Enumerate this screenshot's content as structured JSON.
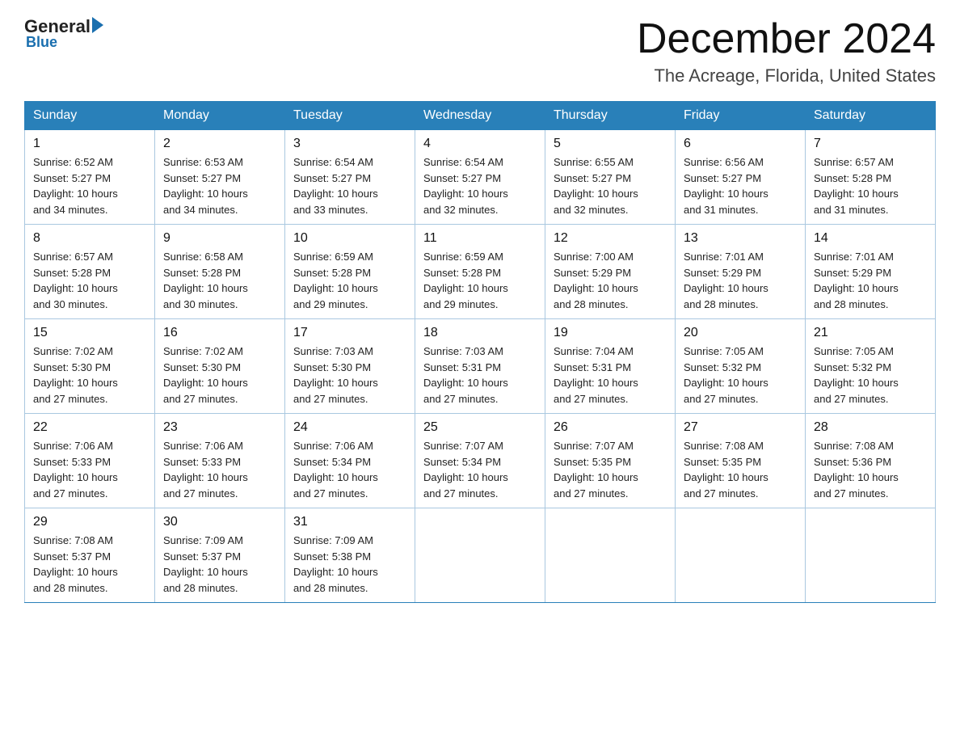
{
  "header": {
    "logo_general": "General",
    "logo_blue": "Blue",
    "title": "December 2024",
    "location": "The Acreage, Florida, United States"
  },
  "weekdays": [
    "Sunday",
    "Monday",
    "Tuesday",
    "Wednesday",
    "Thursday",
    "Friday",
    "Saturday"
  ],
  "weeks": [
    [
      {
        "day": "1",
        "sunrise": "6:52 AM",
        "sunset": "5:27 PM",
        "daylight": "10 hours and 34 minutes."
      },
      {
        "day": "2",
        "sunrise": "6:53 AM",
        "sunset": "5:27 PM",
        "daylight": "10 hours and 34 minutes."
      },
      {
        "day": "3",
        "sunrise": "6:54 AM",
        "sunset": "5:27 PM",
        "daylight": "10 hours and 33 minutes."
      },
      {
        "day": "4",
        "sunrise": "6:54 AM",
        "sunset": "5:27 PM",
        "daylight": "10 hours and 32 minutes."
      },
      {
        "day": "5",
        "sunrise": "6:55 AM",
        "sunset": "5:27 PM",
        "daylight": "10 hours and 32 minutes."
      },
      {
        "day": "6",
        "sunrise": "6:56 AM",
        "sunset": "5:27 PM",
        "daylight": "10 hours and 31 minutes."
      },
      {
        "day": "7",
        "sunrise": "6:57 AM",
        "sunset": "5:28 PM",
        "daylight": "10 hours and 31 minutes."
      }
    ],
    [
      {
        "day": "8",
        "sunrise": "6:57 AM",
        "sunset": "5:28 PM",
        "daylight": "10 hours and 30 minutes."
      },
      {
        "day": "9",
        "sunrise": "6:58 AM",
        "sunset": "5:28 PM",
        "daylight": "10 hours and 30 minutes."
      },
      {
        "day": "10",
        "sunrise": "6:59 AM",
        "sunset": "5:28 PM",
        "daylight": "10 hours and 29 minutes."
      },
      {
        "day": "11",
        "sunrise": "6:59 AM",
        "sunset": "5:28 PM",
        "daylight": "10 hours and 29 minutes."
      },
      {
        "day": "12",
        "sunrise": "7:00 AM",
        "sunset": "5:29 PM",
        "daylight": "10 hours and 28 minutes."
      },
      {
        "day": "13",
        "sunrise": "7:01 AM",
        "sunset": "5:29 PM",
        "daylight": "10 hours and 28 minutes."
      },
      {
        "day": "14",
        "sunrise": "7:01 AM",
        "sunset": "5:29 PM",
        "daylight": "10 hours and 28 minutes."
      }
    ],
    [
      {
        "day": "15",
        "sunrise": "7:02 AM",
        "sunset": "5:30 PM",
        "daylight": "10 hours and 27 minutes."
      },
      {
        "day": "16",
        "sunrise": "7:02 AM",
        "sunset": "5:30 PM",
        "daylight": "10 hours and 27 minutes."
      },
      {
        "day": "17",
        "sunrise": "7:03 AM",
        "sunset": "5:30 PM",
        "daylight": "10 hours and 27 minutes."
      },
      {
        "day": "18",
        "sunrise": "7:03 AM",
        "sunset": "5:31 PM",
        "daylight": "10 hours and 27 minutes."
      },
      {
        "day": "19",
        "sunrise": "7:04 AM",
        "sunset": "5:31 PM",
        "daylight": "10 hours and 27 minutes."
      },
      {
        "day": "20",
        "sunrise": "7:05 AM",
        "sunset": "5:32 PM",
        "daylight": "10 hours and 27 minutes."
      },
      {
        "day": "21",
        "sunrise": "7:05 AM",
        "sunset": "5:32 PM",
        "daylight": "10 hours and 27 minutes."
      }
    ],
    [
      {
        "day": "22",
        "sunrise": "7:06 AM",
        "sunset": "5:33 PM",
        "daylight": "10 hours and 27 minutes."
      },
      {
        "day": "23",
        "sunrise": "7:06 AM",
        "sunset": "5:33 PM",
        "daylight": "10 hours and 27 minutes."
      },
      {
        "day": "24",
        "sunrise": "7:06 AM",
        "sunset": "5:34 PM",
        "daylight": "10 hours and 27 minutes."
      },
      {
        "day": "25",
        "sunrise": "7:07 AM",
        "sunset": "5:34 PM",
        "daylight": "10 hours and 27 minutes."
      },
      {
        "day": "26",
        "sunrise": "7:07 AM",
        "sunset": "5:35 PM",
        "daylight": "10 hours and 27 minutes."
      },
      {
        "day": "27",
        "sunrise": "7:08 AM",
        "sunset": "5:35 PM",
        "daylight": "10 hours and 27 minutes."
      },
      {
        "day": "28",
        "sunrise": "7:08 AM",
        "sunset": "5:36 PM",
        "daylight": "10 hours and 27 minutes."
      }
    ],
    [
      {
        "day": "29",
        "sunrise": "7:08 AM",
        "sunset": "5:37 PM",
        "daylight": "10 hours and 28 minutes."
      },
      {
        "day": "30",
        "sunrise": "7:09 AM",
        "sunset": "5:37 PM",
        "daylight": "10 hours and 28 minutes."
      },
      {
        "day": "31",
        "sunrise": "7:09 AM",
        "sunset": "5:38 PM",
        "daylight": "10 hours and 28 minutes."
      },
      null,
      null,
      null,
      null
    ]
  ],
  "labels": {
    "sunrise": "Sunrise:",
    "sunset": "Sunset:",
    "daylight": "Daylight:"
  }
}
